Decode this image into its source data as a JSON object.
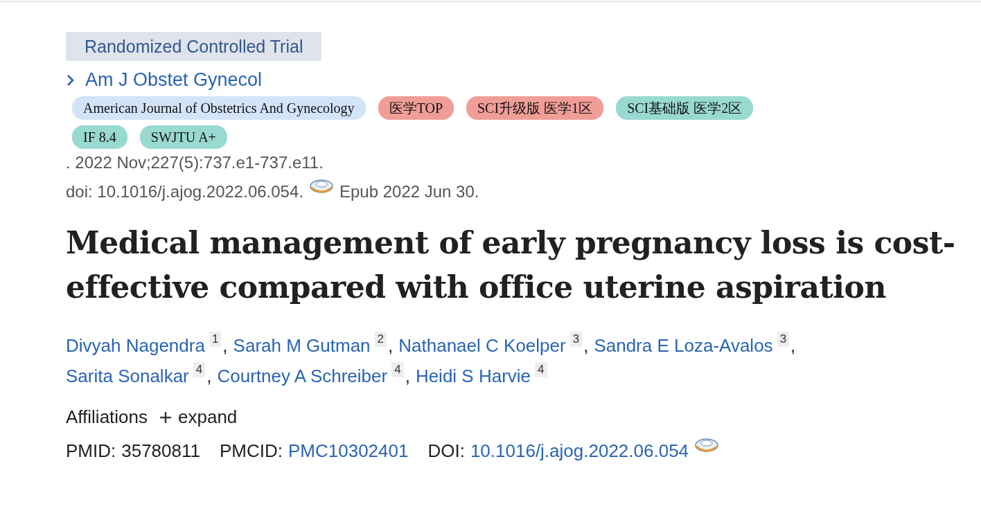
{
  "publication_type": "Randomized Controlled Trial",
  "journal": {
    "abbreviation": "Am J Obstet Gynecol"
  },
  "tags": [
    {
      "label": "American Journal of Obstetrics And Gynecology",
      "color": "#d3e3f8"
    },
    {
      "label": "医学TOP",
      "color": "#f09d98"
    },
    {
      "label": "SCI升级版 医学1区",
      "color": "#f09d98"
    },
    {
      "label": "SCI基础版 医学2区",
      "color": "#98d9d1"
    },
    {
      "label": "IF 8.4",
      "color": "#98d9d1"
    },
    {
      "label": "SWJTU A+",
      "color": "#98d9d1"
    }
  ],
  "citation": ". 2022 Nov;227(5):737.e1-737.e11.",
  "doi_line": {
    "doi": "doi: 10.1016/j.ajog.2022.06.054.",
    "epub": "Epub 2022 Jun 30."
  },
  "title": "Medical management of early pregnancy loss is cost-effective compared with office uterine aspiration",
  "authors": [
    {
      "name": "Divyah Nagendra",
      "affiliation": "1",
      "separator": ","
    },
    {
      "name": "Sarah M Gutman",
      "affiliation": "2",
      "separator": ","
    },
    {
      "name": "Nathanael C Koelper",
      "affiliation": "3",
      "separator": ","
    },
    {
      "name": "Sandra E Loza-Avalos",
      "affiliation": "3",
      "separator": ","
    },
    {
      "name": "Sarita Sonalkar",
      "affiliation": "4",
      "separator": ","
    },
    {
      "name": "Courtney A Schreiber",
      "affiliation": "4",
      "separator": ","
    },
    {
      "name": "Heidi S Harvie",
      "affiliation": "4"
    }
  ],
  "affiliations": {
    "label": "Affiliations",
    "toggle": "expand",
    "expanded": false
  },
  "identifiers": {
    "pmid_label": "PMID:",
    "pmid": "35780811",
    "pmcid_label": "PMCID:",
    "pmcid": "PMC10302401",
    "doi_label": "DOI:",
    "doi": "10.1016/j.ajog.2022.06.054"
  }
}
